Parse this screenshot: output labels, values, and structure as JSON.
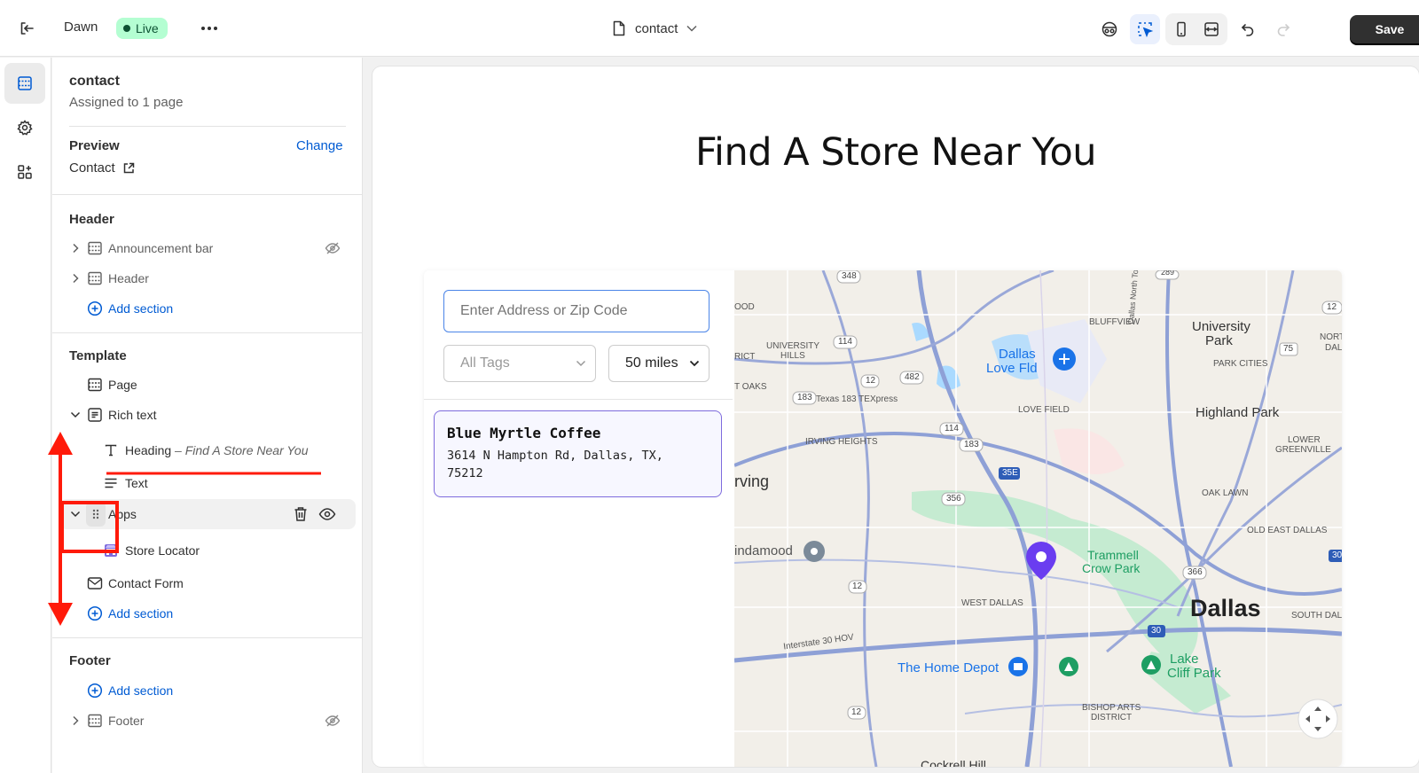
{
  "topbar": {
    "theme_name": "Dawn",
    "live_badge": "Live",
    "page_selector": "contact",
    "save_label": "Save"
  },
  "sidebar": {
    "title": "contact",
    "subtitle": "Assigned to 1 page",
    "preview_label": "Preview",
    "change_label": "Change",
    "preview_value": "Contact",
    "header_group": "Header",
    "header_items": [
      "Announcement bar",
      "Header"
    ],
    "add_section": "Add section",
    "template_group": "Template",
    "template_items": {
      "page": "Page",
      "rich_text": "Rich text",
      "heading": "Heading",
      "heading_value": "– Find A Store Near You",
      "text": "Text",
      "apps": "Apps",
      "store_locator": "Store Locator",
      "contact_form": "Contact Form"
    },
    "footer_group": "Footer",
    "footer_item": "Footer"
  },
  "canvas": {
    "heading": "Find A Store Near You",
    "search_placeholder": "Enter Address or Zip Code",
    "tags_select": "All Tags",
    "distance_select": "50 miles",
    "store": {
      "name": "Blue Myrtle Coffee",
      "address_line1": "3614 N Hampton Rd, Dallas, TX,",
      "address_line2": "75212"
    },
    "map_labels": {
      "dallas_love_fld_1": "Dallas",
      "dallas_love_fld_2": "Love Fld",
      "university_park_1": "University",
      "university_park_2": "Park",
      "highland_park": "Highland Park",
      "bluffview": "BLUFFVIEW",
      "university_hills_1": "UNIVERSITY",
      "university_hills_2": "HILLS",
      "park_cities": "PARK CITIES",
      "north_dal_1": "NORTH",
      "north_dal_2": "DAL",
      "oak_partial": "OOD",
      "rict": "RICT",
      "t_oaks": "T OAKS",
      "love_field": "LOVE FIELD",
      "texas_183": "Texas 183 TEXpress",
      "irving_heights": "IRVING HEIGHTS",
      "lower_greenville_1": "LOWER",
      "lower_greenville_2": "GREENVILLE",
      "irving": "rving",
      "oak_lawn": "OAK LAWN",
      "lindamood": "indamood",
      "trammell_1": "Trammell",
      "trammell_2": "Crow Park",
      "old_east_dallas": "OLD EAST DALLAS",
      "west_dallas": "WEST DALLAS",
      "dallas": "Dallas",
      "south_dal": "SOUTH DAL",
      "interstate_30": "Interstate 30 HOV",
      "home_depot": "The Home Depot",
      "lake_cliff_1": "Lake",
      "lake_cliff_2": "Cliff Park",
      "bishop_arts_1": "BISHOP ARTS",
      "bishop_arts_2": "DISTRICT",
      "dallas_tollway": "Dallas North Tollway",
      "cockrell": "Cockrell Hill",
      "shield_348": "348",
      "shield_114": "114",
      "shield_12a": "12",
      "shield_482": "482",
      "shield_183a": "183",
      "shield_114b": "114",
      "shield_183b": "183",
      "shield_35e": "35E",
      "shield_356": "356",
      "shield_12b": "12",
      "shield_12c": "12",
      "shield_366": "366",
      "shield_30a": "30",
      "shield_30b": "30",
      "shield_12d": "12",
      "shield_75": "75",
      "shield_12e": "12",
      "shield_289": "289"
    }
  },
  "colors": {
    "accent_blue": "#005bd3",
    "live_green_bg": "#b4fed2",
    "annotation_red": "#ff1a0a",
    "store_card_border": "#7e6bdd",
    "map_pin": "#6a3df0"
  }
}
